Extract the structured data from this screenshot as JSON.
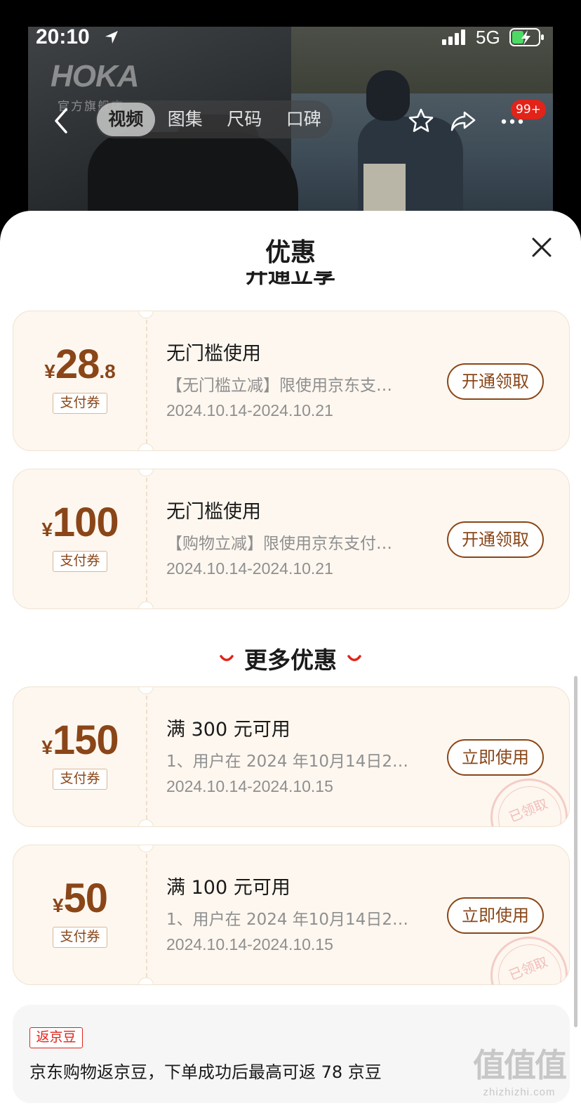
{
  "status": {
    "time": "20:10",
    "network": "5G"
  },
  "product": {
    "brand_logo": "HOKA",
    "brand_sub": "官方旗舰店",
    "tabs": [
      {
        "label": "视频",
        "active": true
      },
      {
        "label": "图集",
        "active": false
      },
      {
        "label": "尺码",
        "active": false
      },
      {
        "label": "口碑",
        "active": false
      }
    ],
    "badge": "99+"
  },
  "sheet": {
    "title": "优惠",
    "section_cut_label": "开通立享",
    "more_label": "更多优惠",
    "coupons": [
      {
        "currency": "¥",
        "amount": "28",
        "decimal": ".8",
        "tag": "支付券",
        "title": "无门槛使用",
        "desc": "【无门槛立减】限使用京东支…",
        "date": "2024.10.14-2024.10.21",
        "button": "开通领取",
        "claimed": false
      },
      {
        "currency": "¥",
        "amount": "100",
        "decimal": "",
        "tag": "支付券",
        "title": "无门槛使用",
        "desc": "【购物立减】限使用京东支付…",
        "date": "2024.10.14-2024.10.21",
        "button": "开通领取",
        "claimed": false
      },
      {
        "currency": "¥",
        "amount": "150",
        "decimal": "",
        "tag": "支付券",
        "title": "满 300 元可用",
        "desc": "1、用户在 2024 年10月14日2…",
        "date": "2024.10.14-2024.10.15",
        "button": "立即使用",
        "claimed": true
      },
      {
        "currency": "¥",
        "amount": "50",
        "decimal": "",
        "tag": "支付券",
        "title": "满 100 元可用",
        "desc": "1、用户在 2024 年10月14日2…",
        "date": "2024.10.14-2024.10.15",
        "button": "立即使用",
        "claimed": true
      }
    ],
    "claimed_stamp": "已领取",
    "rebate": {
      "tag": "返京豆",
      "text": "京东购物返京豆，下单成功后最高可返 78 京豆"
    }
  },
  "watermark": {
    "big": "值值值",
    "small": "zhizhizhi.com"
  },
  "colors": {
    "accent_brown": "#8a4618",
    "coupon_bg": "#fdf7ef",
    "jd_red": "#e2231a"
  }
}
